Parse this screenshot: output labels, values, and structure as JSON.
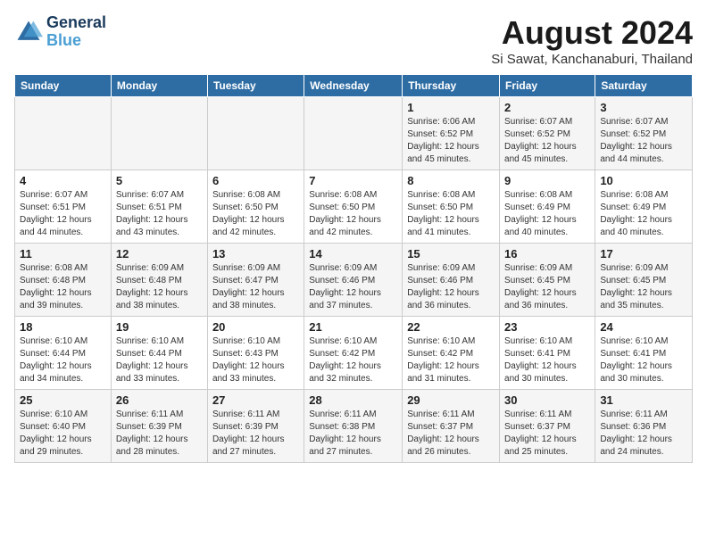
{
  "header": {
    "logo_line1": "General",
    "logo_line2": "Blue",
    "title": "August 2024",
    "subtitle": "Si Sawat, Kanchanaburi, Thailand"
  },
  "days_of_week": [
    "Sunday",
    "Monday",
    "Tuesday",
    "Wednesday",
    "Thursday",
    "Friday",
    "Saturday"
  ],
  "weeks": [
    [
      {
        "num": "",
        "detail": ""
      },
      {
        "num": "",
        "detail": ""
      },
      {
        "num": "",
        "detail": ""
      },
      {
        "num": "",
        "detail": ""
      },
      {
        "num": "1",
        "detail": "Sunrise: 6:06 AM\nSunset: 6:52 PM\nDaylight: 12 hours\nand 45 minutes."
      },
      {
        "num": "2",
        "detail": "Sunrise: 6:07 AM\nSunset: 6:52 PM\nDaylight: 12 hours\nand 45 minutes."
      },
      {
        "num": "3",
        "detail": "Sunrise: 6:07 AM\nSunset: 6:52 PM\nDaylight: 12 hours\nand 44 minutes."
      }
    ],
    [
      {
        "num": "4",
        "detail": "Sunrise: 6:07 AM\nSunset: 6:51 PM\nDaylight: 12 hours\nand 44 minutes."
      },
      {
        "num": "5",
        "detail": "Sunrise: 6:07 AM\nSunset: 6:51 PM\nDaylight: 12 hours\nand 43 minutes."
      },
      {
        "num": "6",
        "detail": "Sunrise: 6:08 AM\nSunset: 6:50 PM\nDaylight: 12 hours\nand 42 minutes."
      },
      {
        "num": "7",
        "detail": "Sunrise: 6:08 AM\nSunset: 6:50 PM\nDaylight: 12 hours\nand 42 minutes."
      },
      {
        "num": "8",
        "detail": "Sunrise: 6:08 AM\nSunset: 6:50 PM\nDaylight: 12 hours\nand 41 minutes."
      },
      {
        "num": "9",
        "detail": "Sunrise: 6:08 AM\nSunset: 6:49 PM\nDaylight: 12 hours\nand 40 minutes."
      },
      {
        "num": "10",
        "detail": "Sunrise: 6:08 AM\nSunset: 6:49 PM\nDaylight: 12 hours\nand 40 minutes."
      }
    ],
    [
      {
        "num": "11",
        "detail": "Sunrise: 6:08 AM\nSunset: 6:48 PM\nDaylight: 12 hours\nand 39 minutes."
      },
      {
        "num": "12",
        "detail": "Sunrise: 6:09 AM\nSunset: 6:48 PM\nDaylight: 12 hours\nand 38 minutes."
      },
      {
        "num": "13",
        "detail": "Sunrise: 6:09 AM\nSunset: 6:47 PM\nDaylight: 12 hours\nand 38 minutes."
      },
      {
        "num": "14",
        "detail": "Sunrise: 6:09 AM\nSunset: 6:46 PM\nDaylight: 12 hours\nand 37 minutes."
      },
      {
        "num": "15",
        "detail": "Sunrise: 6:09 AM\nSunset: 6:46 PM\nDaylight: 12 hours\nand 36 minutes."
      },
      {
        "num": "16",
        "detail": "Sunrise: 6:09 AM\nSunset: 6:45 PM\nDaylight: 12 hours\nand 36 minutes."
      },
      {
        "num": "17",
        "detail": "Sunrise: 6:09 AM\nSunset: 6:45 PM\nDaylight: 12 hours\nand 35 minutes."
      }
    ],
    [
      {
        "num": "18",
        "detail": "Sunrise: 6:10 AM\nSunset: 6:44 PM\nDaylight: 12 hours\nand 34 minutes."
      },
      {
        "num": "19",
        "detail": "Sunrise: 6:10 AM\nSunset: 6:44 PM\nDaylight: 12 hours\nand 33 minutes."
      },
      {
        "num": "20",
        "detail": "Sunrise: 6:10 AM\nSunset: 6:43 PM\nDaylight: 12 hours\nand 33 minutes."
      },
      {
        "num": "21",
        "detail": "Sunrise: 6:10 AM\nSunset: 6:42 PM\nDaylight: 12 hours\nand 32 minutes."
      },
      {
        "num": "22",
        "detail": "Sunrise: 6:10 AM\nSunset: 6:42 PM\nDaylight: 12 hours\nand 31 minutes."
      },
      {
        "num": "23",
        "detail": "Sunrise: 6:10 AM\nSunset: 6:41 PM\nDaylight: 12 hours\nand 30 minutes."
      },
      {
        "num": "24",
        "detail": "Sunrise: 6:10 AM\nSunset: 6:41 PM\nDaylight: 12 hours\nand 30 minutes."
      }
    ],
    [
      {
        "num": "25",
        "detail": "Sunrise: 6:10 AM\nSunset: 6:40 PM\nDaylight: 12 hours\nand 29 minutes."
      },
      {
        "num": "26",
        "detail": "Sunrise: 6:11 AM\nSunset: 6:39 PM\nDaylight: 12 hours\nand 28 minutes."
      },
      {
        "num": "27",
        "detail": "Sunrise: 6:11 AM\nSunset: 6:39 PM\nDaylight: 12 hours\nand 27 minutes."
      },
      {
        "num": "28",
        "detail": "Sunrise: 6:11 AM\nSunset: 6:38 PM\nDaylight: 12 hours\nand 27 minutes."
      },
      {
        "num": "29",
        "detail": "Sunrise: 6:11 AM\nSunset: 6:37 PM\nDaylight: 12 hours\nand 26 minutes."
      },
      {
        "num": "30",
        "detail": "Sunrise: 6:11 AM\nSunset: 6:37 PM\nDaylight: 12 hours\nand 25 minutes."
      },
      {
        "num": "31",
        "detail": "Sunrise: 6:11 AM\nSunset: 6:36 PM\nDaylight: 12 hours\nand 24 minutes."
      }
    ]
  ]
}
